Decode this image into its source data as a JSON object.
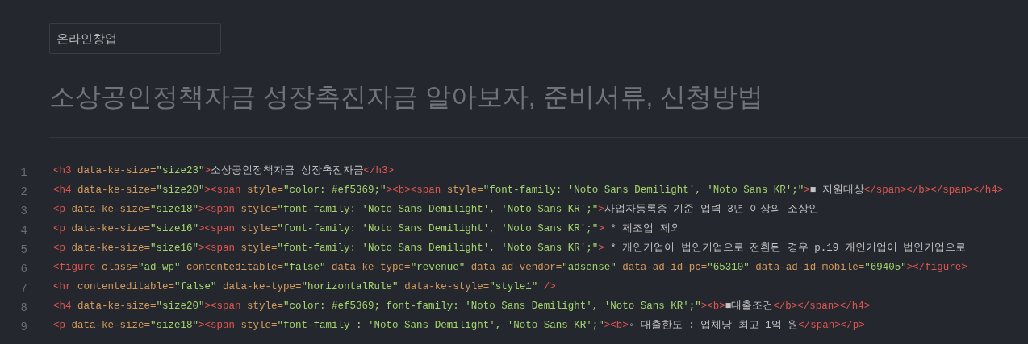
{
  "category_field": {
    "value": "온라인창업"
  },
  "title": "소상공인정책자금 성장촉진자금 알아보자, 준비서류, 신청방법",
  "code_lines": [
    {
      "number": "1",
      "tokens": [
        {
          "kind": "tag",
          "text": "<h3"
        },
        {
          "kind": "attr",
          "text": " data-ke-size="
        },
        {
          "kind": "string",
          "text": "\"size23\""
        },
        {
          "kind": "tag",
          "text": ">"
        },
        {
          "kind": "text",
          "text": "소상공인정책자금 성장촉진자금"
        },
        {
          "kind": "tag",
          "text": "</h3>"
        }
      ]
    },
    {
      "number": "2",
      "tokens": [
        {
          "kind": "tag",
          "text": "<h4"
        },
        {
          "kind": "attr",
          "text": " data-ke-size="
        },
        {
          "kind": "string",
          "text": "\"size20\""
        },
        {
          "kind": "tag",
          "text": "><span"
        },
        {
          "kind": "attr",
          "text": " style="
        },
        {
          "kind": "string",
          "text": "\"color: #ef5369;\""
        },
        {
          "kind": "tag",
          "text": "><b><span"
        },
        {
          "kind": "attr",
          "text": " style="
        },
        {
          "kind": "string",
          "text": "\"font-family: 'Noto Sans Demilight', 'Noto Sans KR';\""
        },
        {
          "kind": "tag",
          "text": ">"
        },
        {
          "kind": "text",
          "text": "■ 지원대상"
        },
        {
          "kind": "tag",
          "text": "</span></b></span></h4>"
        }
      ]
    },
    {
      "number": "3",
      "tokens": [
        {
          "kind": "tag",
          "text": "<p"
        },
        {
          "kind": "attr",
          "text": " data-ke-size="
        },
        {
          "kind": "string",
          "text": "\"size18\""
        },
        {
          "kind": "tag",
          "text": "><span"
        },
        {
          "kind": "attr",
          "text": " style="
        },
        {
          "kind": "string",
          "text": "\"font-family: 'Noto Sans Demilight', 'Noto Sans KR';\""
        },
        {
          "kind": "tag",
          "text": ">"
        },
        {
          "kind": "text",
          "text": "사업자등록증 기준 업력 3년 이상의 소상인"
        }
      ]
    },
    {
      "number": "4",
      "tokens": [
        {
          "kind": "tag",
          "text": "<p"
        },
        {
          "kind": "attr",
          "text": " data-ke-size="
        },
        {
          "kind": "string",
          "text": "\"size16\""
        },
        {
          "kind": "tag",
          "text": "><span"
        },
        {
          "kind": "attr",
          "text": " style="
        },
        {
          "kind": "string",
          "text": "\"font-family: 'Noto Sans Demilight', 'Noto Sans KR';\""
        },
        {
          "kind": "tag",
          "text": ">"
        },
        {
          "kind": "text",
          "text": " * 제조업 제외"
        }
      ]
    },
    {
      "number": "5",
      "tokens": [
        {
          "kind": "tag",
          "text": "<p"
        },
        {
          "kind": "attr",
          "text": " data-ke-size="
        },
        {
          "kind": "string",
          "text": "\"size16\""
        },
        {
          "kind": "tag",
          "text": "><span"
        },
        {
          "kind": "attr",
          "text": " style="
        },
        {
          "kind": "string",
          "text": "\"font-family: 'Noto Sans Demilight', 'Noto Sans KR';\""
        },
        {
          "kind": "tag",
          "text": ">"
        },
        {
          "kind": "text",
          "text": " * 개인기업이 법인기업으로 전환된 경우 p.19 개인기업이 법인기업으로"
        }
      ]
    },
    {
      "number": "6",
      "tokens": [
        {
          "kind": "tag",
          "text": "<figure"
        },
        {
          "kind": "attr",
          "text": " class="
        },
        {
          "kind": "string",
          "text": "\"ad-wp\""
        },
        {
          "kind": "attr",
          "text": " contenteditable="
        },
        {
          "kind": "string",
          "text": "\"false\""
        },
        {
          "kind": "attr",
          "text": " data-ke-type="
        },
        {
          "kind": "string",
          "text": "\"revenue\""
        },
        {
          "kind": "attr",
          "text": " data-ad-vendor="
        },
        {
          "kind": "string",
          "text": "\"adsense\""
        },
        {
          "kind": "attr",
          "text": " data-ad-id-pc="
        },
        {
          "kind": "string",
          "text": "\"65310\""
        },
        {
          "kind": "attr",
          "text": " data-ad-id-mobile="
        },
        {
          "kind": "string",
          "text": "\"69405\""
        },
        {
          "kind": "tag",
          "text": "></figure>"
        }
      ]
    },
    {
      "number": "7",
      "tokens": [
        {
          "kind": "tag",
          "text": "<hr"
        },
        {
          "kind": "attr",
          "text": " contenteditable="
        },
        {
          "kind": "string",
          "text": "\"false\""
        },
        {
          "kind": "attr",
          "text": " data-ke-type="
        },
        {
          "kind": "string",
          "text": "\"horizontalRule\""
        },
        {
          "kind": "attr",
          "text": " data-ke-style="
        },
        {
          "kind": "string",
          "text": "\"style1\""
        },
        {
          "kind": "tag",
          "text": " />"
        }
      ]
    },
    {
      "number": "8",
      "tokens": [
        {
          "kind": "tag",
          "text": "<h4"
        },
        {
          "kind": "attr",
          "text": " data-ke-size="
        },
        {
          "kind": "string",
          "text": "\"size20\""
        },
        {
          "kind": "tag",
          "text": "><span"
        },
        {
          "kind": "attr",
          "text": " style="
        },
        {
          "kind": "string",
          "text": "\"color: #ef5369; font-family: 'Noto Sans Demilight', 'Noto Sans KR';\""
        },
        {
          "kind": "tag",
          "text": "><b>"
        },
        {
          "kind": "text",
          "text": "■대출조건"
        },
        {
          "kind": "tag",
          "text": "</b></span></h4>"
        }
      ]
    },
    {
      "number": "9",
      "tokens": [
        {
          "kind": "tag",
          "text": "<p"
        },
        {
          "kind": "attr",
          "text": " data-ke-size="
        },
        {
          "kind": "string",
          "text": "\"size18\""
        },
        {
          "kind": "tag",
          "text": "><span"
        },
        {
          "kind": "attr",
          "text": " style="
        },
        {
          "kind": "string",
          "text": "\"font-family : 'Noto Sans Demilight', 'Noto Sans KR';\""
        },
        {
          "kind": "tag",
          "text": "><b>"
        },
        {
          "kind": "text",
          "text": "◦ 대출한도 : 업체당 최고 1억 원"
        },
        {
          "kind": "tag",
          "text": "</span></p>"
        }
      ]
    }
  ]
}
